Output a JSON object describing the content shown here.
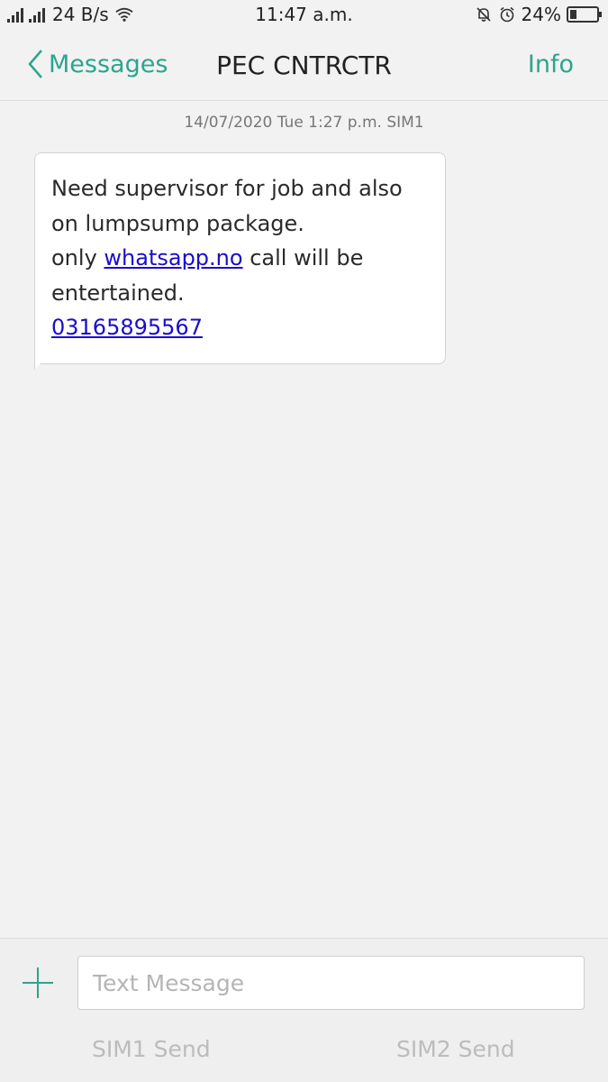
{
  "status_bar": {
    "speed": "24 B/s",
    "time": "11:47 a.m.",
    "battery": "24%",
    "battery_level": 0.24
  },
  "header": {
    "back_label": "Messages",
    "title": "PEC CNTRCTR",
    "info_label": "Info"
  },
  "conversation": {
    "timestamp": "14/07/2020 Tue 1:27 p.m.  SIM1",
    "message": {
      "line1": "Need supervisor for job and also",
      "line2": "on lumpsump package.",
      "line3_pre": "only ",
      "link": "whatsapp.no",
      "line3_post": " call will be",
      "line4": "entertained.",
      "phone": "03165895567"
    }
  },
  "composer": {
    "placeholder": "Text Message",
    "sim1_send": "SIM1 Send",
    "sim2_send": "SIM2 Send"
  },
  "colors": {
    "accent": "#2ca58d",
    "link": "#1a0dcc"
  }
}
